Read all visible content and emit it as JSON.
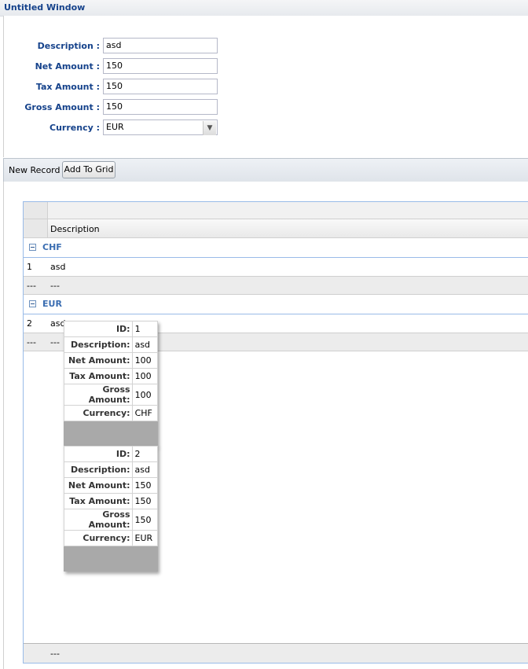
{
  "window": {
    "title": "Untitled Window"
  },
  "form": {
    "fields": [
      {
        "label": "Description :",
        "value": "asd"
      },
      {
        "label": "Net Amount :",
        "value": "150"
      },
      {
        "label": "Tax Amount :",
        "value": "150"
      },
      {
        "label": "Gross Amount :",
        "value": "150"
      }
    ],
    "currency": {
      "label": "Currency :",
      "value": "EUR"
    }
  },
  "toolbar": {
    "text": "New Record",
    "add_button_label": "Add To Grid"
  },
  "grid": {
    "column_header": "Description",
    "groups": [
      {
        "name": "CHF",
        "rows": [
          {
            "num": "1",
            "description": "asd"
          }
        ],
        "summary": {
          "num": "---",
          "description": "---"
        }
      },
      {
        "name": "EUR",
        "rows": [
          {
            "num": "2",
            "description": "asd"
          }
        ],
        "summary": {
          "num": "---",
          "description": "---"
        }
      }
    ],
    "footer": {
      "description": "---"
    }
  },
  "tooltip": {
    "records": [
      {
        "rows": [
          {
            "key": "ID:",
            "value": "1"
          },
          {
            "key": "Description:",
            "value": "asd"
          },
          {
            "key": "Net Amount:",
            "value": "100"
          },
          {
            "key": "Tax Amount:",
            "value": "100"
          },
          {
            "key": "Gross Amount:",
            "value": "100"
          },
          {
            "key": "Currency:",
            "value": "CHF"
          }
        ]
      },
      {
        "rows": [
          {
            "key": "ID:",
            "value": "2"
          },
          {
            "key": "Description:",
            "value": "asd"
          },
          {
            "key": "Net Amount:",
            "value": "150"
          },
          {
            "key": "Tax Amount:",
            "value": "150"
          },
          {
            "key": "Gross Amount:",
            "value": "150"
          },
          {
            "key": "Currency:",
            "value": "EUR"
          }
        ]
      }
    ]
  }
}
